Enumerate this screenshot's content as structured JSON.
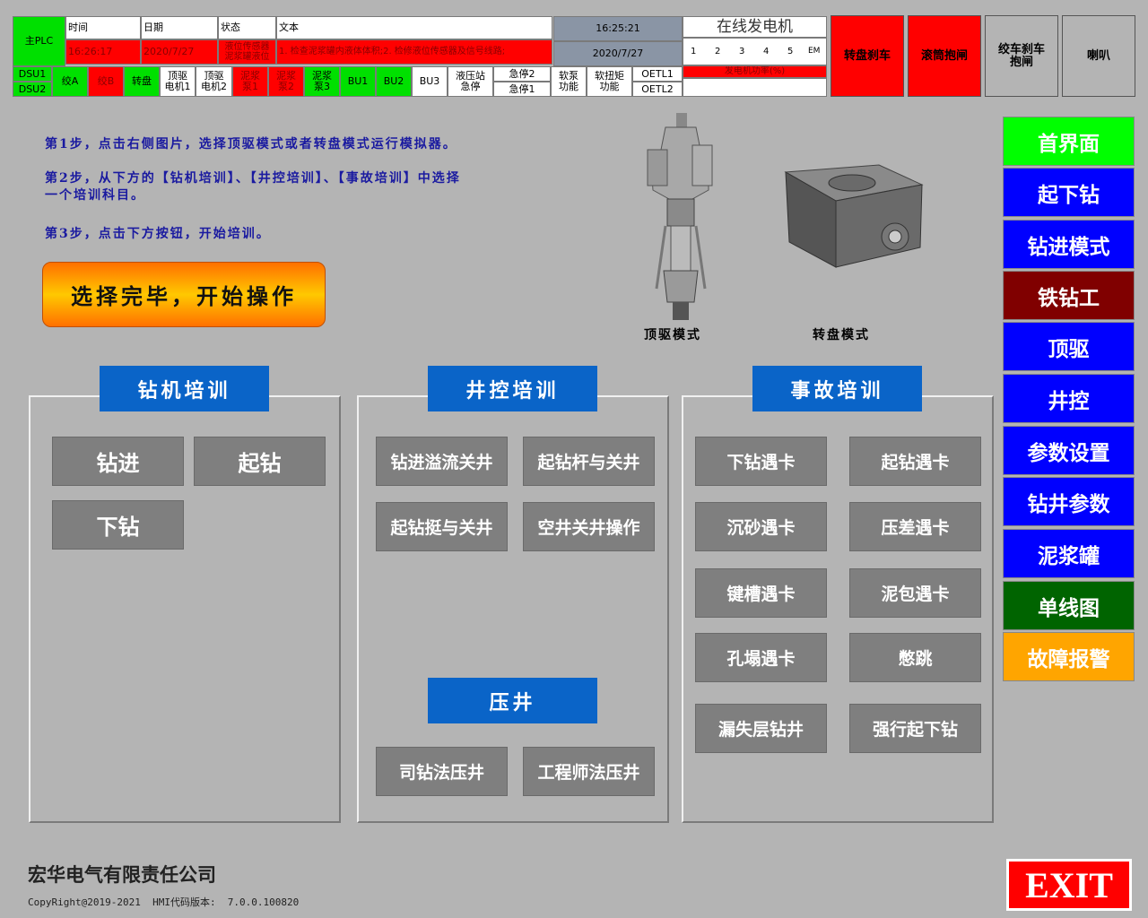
{
  "header": {
    "plc_label": "主PLC",
    "time_label": "时间",
    "date_label": "日期",
    "status_label": "状态",
    "text_label": "文本",
    "time_value": "16:26:17",
    "date_value": "2020/7/27",
    "status_value": "液位传感器",
    "status_value2": "泥浆罐液位",
    "text_value": "1. 检查泥浆罐内液体体积;2. 检修液位传感器及信号线路;",
    "clock_time": "16:25:21",
    "clock_date": "2020/7/27",
    "generator_title": "在线发电机",
    "generator_nums": [
      "1",
      "2",
      "3",
      "4",
      "5",
      "EM"
    ],
    "generator_power": "发电机功率(%)",
    "dsu1": "DSU1",
    "dsu2": "DSU2",
    "row2": {
      "jiaoA": "绞A",
      "jiaoB": "绞B",
      "zhuanpan": "转盘",
      "dingqu1": "顶驱\n电机1",
      "dingqu2": "顶驱\n电机2",
      "nijiang1": "泥浆\n泵1",
      "nijiang2": "泥浆\n泵2",
      "nijiang3": "泥浆\n泵3",
      "bu1": "BU1",
      "bu2": "BU2",
      "bu3": "BU3",
      "yeya": "液压站\n急停",
      "jiting2": "急停2",
      "jiting1": "急停1",
      "ruanbeng": "软泵\n功能",
      "ruanniu": "软扭矩\n功能",
      "oetl1": "OETL1",
      "oetl2": "OETL2"
    },
    "buttons": {
      "zhuanpan_brake": "转盘刹车",
      "guntong": "滚筒抱闸",
      "jiaoche": "绞车刹车\n抱闸",
      "laba": "喇叭"
    }
  },
  "steps": [
    "第1步，点击右侧图片，选择顶驱模式或者转盘模式运行模拟器。",
    "第2步，从下方的【钻机培训】、【井控培训】、【事故培训】中选择",
    "一个培训科目。",
    "第3步，点击下方按钮，开始培训。"
  ],
  "start_button": "选择完毕，开始操作",
  "mode_labels": {
    "topdrive": "顶驱模式",
    "rotary": "转盘模式"
  },
  "panels": {
    "drilling": {
      "title": "钻机培训",
      "buttons": [
        "钻进",
        "起钻",
        "下钻"
      ]
    },
    "wellcontrol": {
      "title": "井控培训",
      "buttons": [
        "钻进溢流关井",
        "起钻杆与关井",
        "起钻挺与关井",
        "空井关井操作"
      ],
      "kill_title": "压井",
      "kill_buttons": [
        "司钻法压井",
        "工程师法压井"
      ]
    },
    "accident": {
      "title": "事故培训",
      "buttons": [
        "下钻遇卡",
        "起钻遇卡",
        "沉砂遇卡",
        "压差遇卡",
        "键槽遇卡",
        "泥包遇卡",
        "孔塌遇卡",
        "憋跳",
        "漏失层钻井",
        "强行起下钻"
      ]
    }
  },
  "nav": [
    "首界面",
    "起下钻",
    "钻进模式",
    "铁钻工",
    "顶驱",
    "井控",
    "参数设置",
    "钻井参数",
    "泥浆罐",
    "单线图",
    "故障报警"
  ],
  "footer": {
    "company": "宏华电气有限责任公司",
    "copyright": "CopyRight@2019-2021  HMI代码版本:  7.0.0.100820",
    "exit": "EXIT"
  },
  "colors": {
    "background": "#b4b4b4",
    "panel_title": "#0a64c8",
    "nav_green": "#00ff00",
    "nav_blue": "#0000ff",
    "nav_darkred": "#800000",
    "nav_darkgreen": "#006400",
    "nav_orange": "#ffa500",
    "alarm_red": "#ff0000",
    "ok_green": "#00e000"
  }
}
